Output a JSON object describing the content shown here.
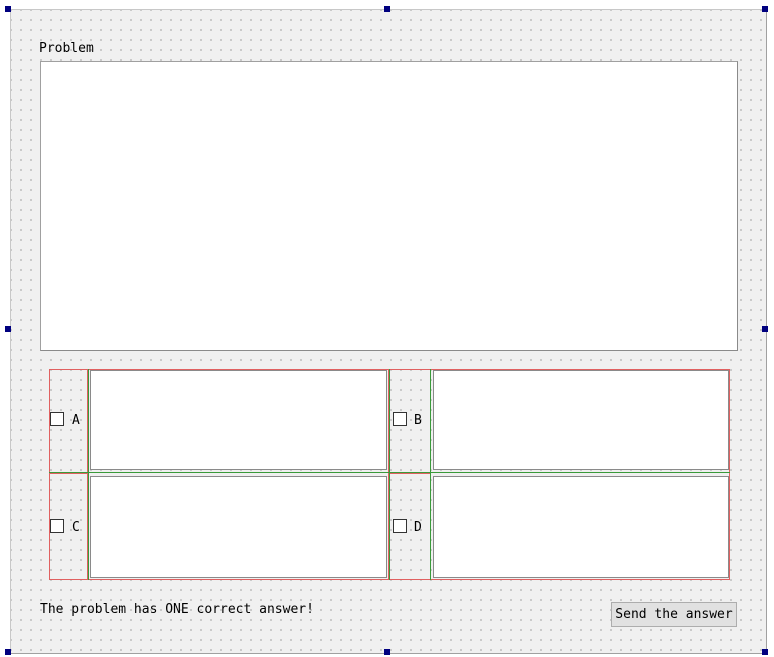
{
  "problem": {
    "label": "Problem",
    "text": ""
  },
  "options": [
    {
      "letter": "A",
      "checked": false,
      "answer_text": ""
    },
    {
      "letter": "B",
      "checked": false,
      "answer_text": ""
    },
    {
      "letter": "C",
      "checked": false,
      "answer_text": ""
    },
    {
      "letter": "D",
      "checked": false,
      "answer_text": ""
    }
  ],
  "footer": {
    "hint": "The problem has ONE correct answer!",
    "send_button_label": "Send the answer"
  },
  "colors": {
    "canvas_background": "#f0f0f0",
    "grid_dot": "#9a9a9a",
    "selection_handle": "#00007f",
    "layout_border_red": "#e06060",
    "layout_border_green": "#3a9a3a"
  }
}
